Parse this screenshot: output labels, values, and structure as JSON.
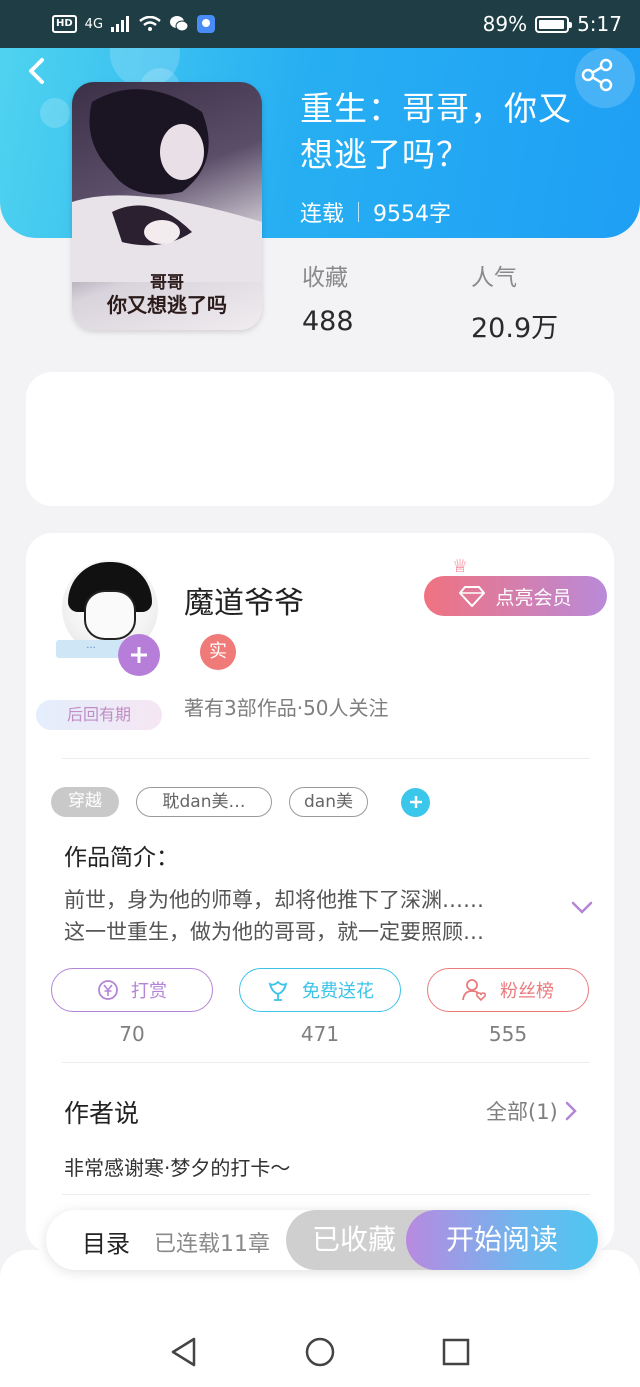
{
  "status_bar": {
    "hd": "HD",
    "network": "4G",
    "battery_text": "89%",
    "battery_level": 0.89,
    "time": "5:17"
  },
  "book": {
    "title": "重生：哥哥，你又想逃了吗？",
    "status": "连载",
    "word_count": "9554字",
    "cover_text_line1": "哥哥",
    "cover_text_line2": "你又想逃了吗",
    "stats": [
      {
        "label": "收藏",
        "value": "488"
      },
      {
        "label": "人气",
        "value": "20.9万"
      }
    ]
  },
  "author": {
    "name": "魔道爷爷",
    "real_badge": "实",
    "summary": "著有3部作品·50人关注",
    "later_badge": "后回有期",
    "vip_button": "点亮会员"
  },
  "tags": [
    "穿越",
    "耽dan美…",
    "dan美"
  ],
  "intro": {
    "title": "作品简介：",
    "line1": "前世，身为他的师尊，却将他推下了深渊……",
    "line2": "这一世重生，做为他的哥哥，就一定要照顾…"
  },
  "actions": [
    {
      "label": "打赏",
      "count": "70",
      "color": "#b485d6"
    },
    {
      "label": "免费送花",
      "count": "471",
      "color": "#3cc3e8"
    },
    {
      "label": "粉丝榜",
      "count": "555",
      "color": "#ea7b7d"
    }
  ],
  "author_says": {
    "title": "作者说",
    "all_link": "全部(1)",
    "text": "非常感谢寒·梦夕的打卡～"
  },
  "bottom_bar": {
    "catalog": "目录",
    "chapters": "已连载11章",
    "favorited": "已收藏",
    "start_reading": "开始阅读"
  }
}
